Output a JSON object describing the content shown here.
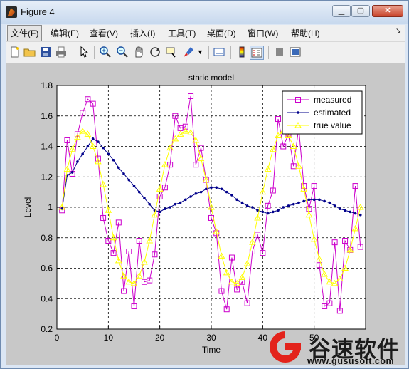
{
  "window": {
    "title": "Figure 4"
  },
  "menu": [
    {
      "id": "file",
      "label": "文件(F)"
    },
    {
      "id": "edit",
      "label": "编辑(E)"
    },
    {
      "id": "view",
      "label": "查看(V)"
    },
    {
      "id": "insert",
      "label": "插入(I)"
    },
    {
      "id": "tools",
      "label": "工具(T)"
    },
    {
      "id": "desktop",
      "label": "桌面(D)"
    },
    {
      "id": "window",
      "label": "窗口(W)"
    },
    {
      "id": "help",
      "label": "帮助(H)"
    }
  ],
  "toolbar": {
    "icons": [
      "new-figure-icon",
      "open-file-icon",
      "save-icon",
      "print-icon",
      "pointer-icon",
      "zoom-in-icon",
      "zoom-out-icon",
      "pan-hand-icon",
      "rotate-3d-icon",
      "data-cursor-icon",
      "brush-icon",
      "link-icon",
      "colorbar-icon",
      "legend-icon",
      "hide-plot-tools-icon",
      "show-plot-tools-icon"
    ]
  },
  "chart_data": {
    "type": "line",
    "title": "static model",
    "xlabel": "Time",
    "ylabel": "Level",
    "xlim": [
      0,
      60
    ],
    "ylim": [
      0.2,
      1.8
    ],
    "xticks": [
      0,
      10,
      20,
      30,
      40,
      50
    ],
    "yticks": [
      0.2,
      0.4,
      0.6,
      0.8,
      1,
      1.2,
      1.4,
      1.6,
      1.8
    ],
    "grid": true,
    "legend_position": "top-right",
    "x": [
      1,
      2,
      3,
      4,
      5,
      6,
      7,
      8,
      9,
      10,
      11,
      12,
      13,
      14,
      15,
      16,
      17,
      18,
      19,
      20,
      21,
      22,
      23,
      24,
      25,
      26,
      27,
      28,
      29,
      30,
      31,
      32,
      33,
      34,
      35,
      36,
      37,
      38,
      39,
      40,
      41,
      42,
      43,
      44,
      45,
      46,
      47,
      48,
      49,
      50,
      51,
      52,
      53,
      54,
      55,
      56,
      57,
      58,
      59,
      60
    ],
    "series": [
      {
        "name": "measured",
        "color": "#cc00cc",
        "marker": "square",
        "values": [
          0.98,
          1.44,
          1.22,
          1.48,
          1.62,
          1.71,
          1.68,
          1.32,
          0.93,
          0.78,
          0.7,
          0.9,
          0.45,
          0.71,
          0.35,
          0.78,
          0.51,
          0.52,
          0.69,
          1.07,
          1.13,
          1.28,
          1.6,
          1.52,
          1.53,
          1.73,
          1.28,
          1.39,
          1.18,
          0.93,
          0.83,
          0.45,
          0.33,
          0.67,
          0.46,
          0.51,
          0.37,
          0.71,
          0.82,
          0.7,
          1.01,
          1.11,
          1.58,
          1.4,
          1.48,
          1.27,
          1.52,
          1.14,
          0.99,
          1.14,
          0.62,
          0.35,
          0.37,
          0.77,
          0.32,
          0.78,
          0.72,
          1.14,
          0.74,
          null
        ]
      },
      {
        "name": "estimated",
        "color": "#00008b",
        "marker": "dot",
        "values": [
          0.99,
          1.21,
          1.23,
          1.3,
          1.35,
          1.4,
          1.45,
          1.43,
          1.39,
          1.35,
          1.31,
          1.26,
          1.22,
          1.18,
          1.14,
          1.1,
          1.06,
          1.02,
          0.98,
          0.97,
          0.99,
          1.0,
          1.02,
          1.03,
          1.05,
          1.07,
          1.09,
          1.1,
          1.12,
          1.13,
          1.13,
          1.12,
          1.1,
          1.08,
          1.05,
          1.03,
          1.01,
          1.0,
          0.98,
          0.97,
          0.96,
          0.97,
          0.98,
          1.0,
          1.01,
          1.02,
          1.03,
          1.04,
          1.05,
          1.05,
          1.05,
          1.04,
          1.03,
          1.01,
          0.99,
          0.98,
          0.97,
          0.96,
          0.95,
          null
        ]
      },
      {
        "name": "true value",
        "color": "#ffff00",
        "marker": "triangle",
        "values": [
          1.0,
          1.25,
          1.38,
          1.46,
          1.5,
          1.48,
          1.4,
          1.3,
          1.15,
          0.98,
          0.8,
          0.65,
          0.55,
          0.51,
          0.5,
          0.55,
          0.64,
          0.78,
          0.95,
          1.12,
          1.28,
          1.39,
          1.45,
          1.48,
          1.5,
          1.49,
          1.44,
          1.32,
          1.18,
          1.0,
          0.84,
          0.68,
          0.57,
          0.51,
          0.5,
          0.54,
          0.63,
          0.77,
          0.93,
          1.1,
          1.25,
          1.38,
          1.47,
          1.5,
          1.47,
          1.4,
          1.27,
          1.12,
          0.95,
          0.79,
          0.66,
          0.56,
          0.51,
          0.5,
          0.53,
          0.6,
          0.72,
          0.86,
          1.0,
          null
        ]
      }
    ]
  },
  "watermark": {
    "brand": "谷速软件",
    "url": "www.gususoft.com"
  }
}
